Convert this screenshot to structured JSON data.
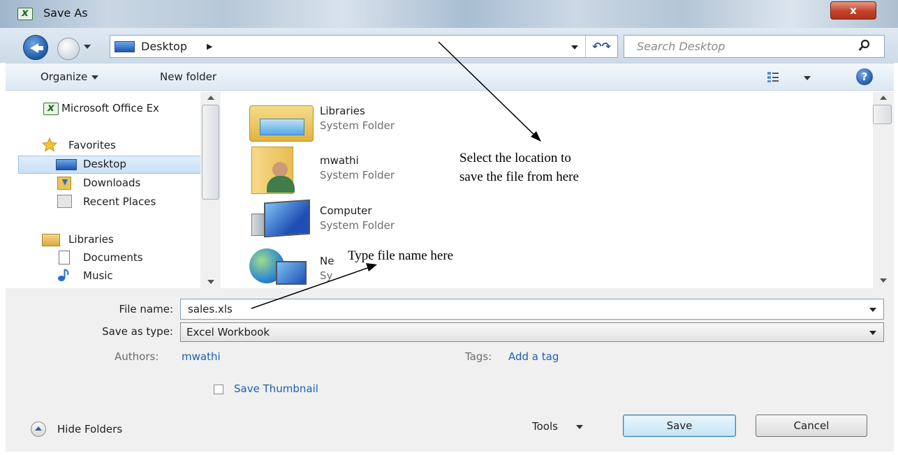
{
  "window": {
    "title": "Save As",
    "close_glyph": "x"
  },
  "address": {
    "location": "Desktop",
    "search_placeholder": "Search Desktop"
  },
  "commands": {
    "organize": "Organize",
    "new_folder": "New folder",
    "help_glyph": "?"
  },
  "nav": [
    {
      "label": "Microsoft Office Ex",
      "icon": "excel-icon"
    },
    {
      "label": "Favorites",
      "icon": "star-icon"
    },
    {
      "label": "Desktop",
      "icon": "desktop-icon",
      "selected": true
    },
    {
      "label": "Downloads",
      "icon": "downloads-icon"
    },
    {
      "label": "Recent Places",
      "icon": "recent-places-icon"
    },
    {
      "label": "Libraries",
      "icon": "libraries-icon"
    },
    {
      "label": "Documents",
      "icon": "document-icon"
    },
    {
      "label": "Music",
      "icon": "music-icon"
    }
  ],
  "items": [
    {
      "name": "Libraries",
      "type": "System Folder",
      "icon": "libraries-folder-icon"
    },
    {
      "name": "mwathi",
      "type": "System Folder",
      "icon": "user-folder-icon"
    },
    {
      "name": "Computer",
      "type": "System Folder",
      "icon": "computer-icon"
    },
    {
      "name": "Ne",
      "type": "Sy",
      "icon": "network-icon"
    }
  ],
  "form": {
    "file_name_label": "File name:",
    "file_name_value": "sales.xls",
    "save_type_label": "Save as type:",
    "save_type_value": "Excel Workbook",
    "authors_label": "Authors:",
    "authors_value": "mwathi",
    "tags_label": "Tags:",
    "tags_value": "Add a tag",
    "thumbnail_label": "Save Thumbnail"
  },
  "footer": {
    "hide_folders": "Hide Folders",
    "tools": "Tools",
    "save": "Save",
    "cancel": "Cancel"
  },
  "annotations": {
    "location_line1": "Select the location to",
    "location_line2": "save the file from here",
    "filename_note": "Type file name here"
  },
  "colors": {
    "accent": "#1e5fb4",
    "selection": "#cce4f7"
  }
}
